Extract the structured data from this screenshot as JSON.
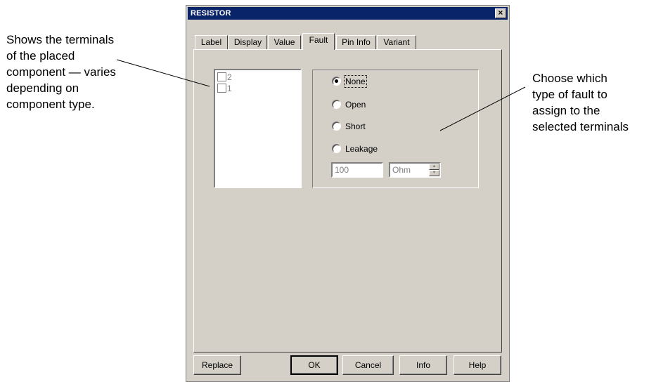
{
  "annotations": {
    "left_lines": [
      "Shows the terminals",
      "of the placed",
      "component — varies",
      "depending on",
      "component type."
    ],
    "right_lines": [
      "Choose which",
      "type of fault to",
      "assign to the",
      "selected terminals"
    ]
  },
  "dialog": {
    "title": "RESISTOR",
    "close_label": "×",
    "tabs": [
      {
        "label": "Label",
        "active": false
      },
      {
        "label": "Display",
        "active": false
      },
      {
        "label": "Value",
        "active": false
      },
      {
        "label": "Fault",
        "active": true
      },
      {
        "label": "Pin Info",
        "active": false
      },
      {
        "label": "Variant",
        "active": false
      }
    ],
    "terminals": [
      "2",
      "1"
    ],
    "fault_options": [
      {
        "label": "None",
        "selected": true
      },
      {
        "label": "Open",
        "selected": false
      },
      {
        "label": "Short",
        "selected": false
      },
      {
        "label": "Leakage",
        "selected": false
      }
    ],
    "leakage_value": "100",
    "leakage_unit": "Ohm",
    "buttons": {
      "replace": "Replace",
      "ok": "OK",
      "cancel": "Cancel",
      "info": "Info",
      "help": "Help"
    }
  },
  "colors": {
    "dialog_face": "#d4d0c8",
    "titlebar": "#0a246a",
    "disabled_text": "#808080"
  }
}
